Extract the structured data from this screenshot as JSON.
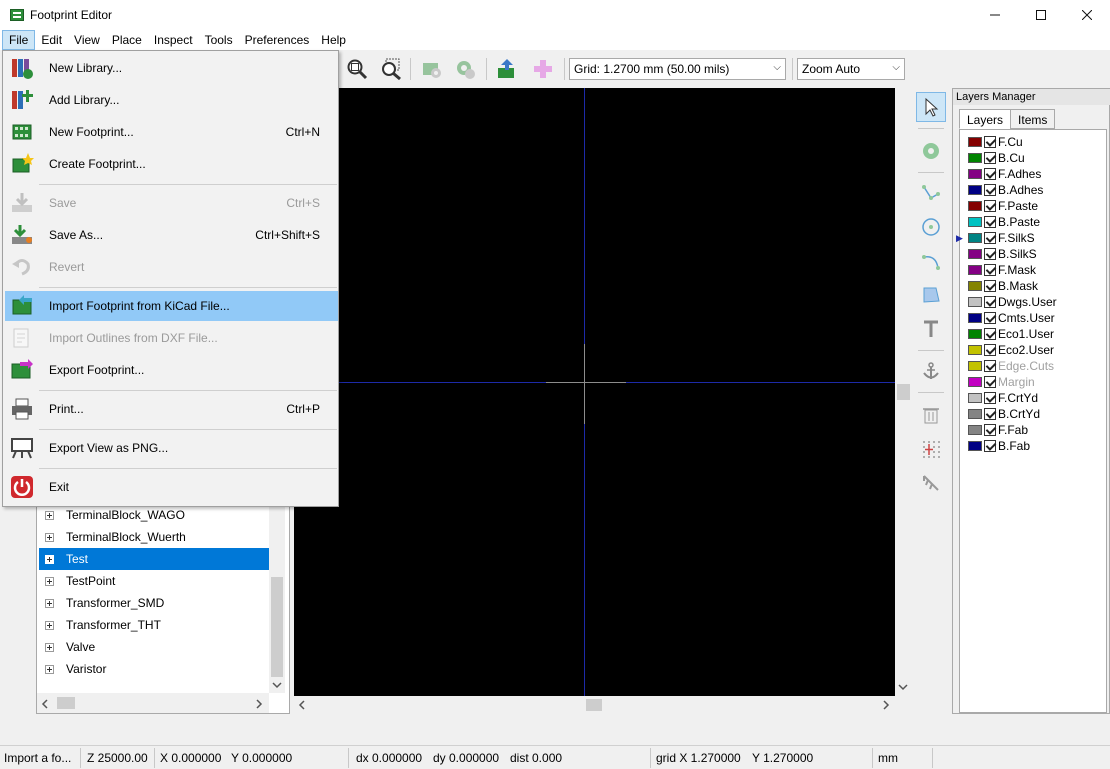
{
  "window": {
    "title": "Footprint Editor"
  },
  "menubar": {
    "items": [
      "File",
      "Edit",
      "View",
      "Place",
      "Inspect",
      "Tools",
      "Preferences",
      "Help"
    ]
  },
  "toolbar": {
    "grid_select": "Grid: 1.2700 mm (50.00 mils)",
    "zoom_select": "Zoom Auto"
  },
  "file_menu": {
    "items": [
      {
        "label": "New Library...",
        "shortcut": "",
        "icon": "new-library-icon"
      },
      {
        "label": "Add Library...",
        "shortcut": "",
        "icon": "add-library-icon"
      },
      {
        "label": "New Footprint...",
        "shortcut": "Ctrl+N",
        "icon": "new-footprint-icon"
      },
      {
        "label": "Create Footprint...",
        "shortcut": "",
        "icon": "create-footprint-icon"
      },
      {
        "label": "Save",
        "shortcut": "Ctrl+S",
        "icon": "save-icon"
      },
      {
        "label": "Save As...",
        "shortcut": "Ctrl+Shift+S",
        "icon": "save-as-icon"
      },
      {
        "label": "Revert",
        "shortcut": "",
        "icon": "revert-icon"
      },
      {
        "label": "Import Footprint from KiCad File...",
        "shortcut": "",
        "icon": "import-footprint-icon"
      },
      {
        "label": "Import Outlines from DXF File...",
        "shortcut": "",
        "icon": "import-dxf-icon"
      },
      {
        "label": "Export Footprint...",
        "shortcut": "",
        "icon": "export-footprint-icon"
      },
      {
        "label": "Print...",
        "shortcut": "Ctrl+P",
        "icon": "print-icon"
      },
      {
        "label": "Export View as PNG...",
        "shortcut": "",
        "icon": "export-png-icon"
      },
      {
        "label": "Exit",
        "shortcut": "",
        "icon": "exit-icon"
      }
    ]
  },
  "libraries": {
    "items": [
      "TerminalBlock_WAGO",
      "TerminalBlock_Wuerth",
      "Test",
      "TestPoint",
      "Transformer_SMD",
      "Transformer_THT",
      "Valve",
      "Varistor"
    ],
    "selected": "Test"
  },
  "layers_manager": {
    "title": "Layers Manager",
    "tabs": [
      "Layers",
      "Items"
    ],
    "active_tab": "Layers",
    "active_layer": "F.SilkS",
    "layers": [
      {
        "name": "F.Cu",
        "color": "#840000"
      },
      {
        "name": "B.Cu",
        "color": "#008400"
      },
      {
        "name": "F.Adhes",
        "color": "#840084"
      },
      {
        "name": "B.Adhes",
        "color": "#000084"
      },
      {
        "name": "F.Paste",
        "color": "#840000"
      },
      {
        "name": "B.Paste",
        "color": "#00c2c2"
      },
      {
        "name": "F.SilkS",
        "color": "#008484"
      },
      {
        "name": "B.SilkS",
        "color": "#840084"
      },
      {
        "name": "F.Mask",
        "color": "#840084"
      },
      {
        "name": "B.Mask",
        "color": "#848400"
      },
      {
        "name": "Dwgs.User",
        "color": "#c2c2c2"
      },
      {
        "name": "Cmts.User",
        "color": "#000084"
      },
      {
        "name": "Eco1.User",
        "color": "#008400"
      },
      {
        "name": "Eco2.User",
        "color": "#c2c200"
      },
      {
        "name": "Edge.Cuts",
        "color": "#c2c200"
      },
      {
        "name": "Margin",
        "color": "#c200c2"
      },
      {
        "name": "F.CrtYd",
        "color": "#c2c2c2"
      },
      {
        "name": "B.CrtYd",
        "color": "#848484"
      },
      {
        "name": "F.Fab",
        "color": "#848484"
      },
      {
        "name": "B.Fab",
        "color": "#000084"
      }
    ]
  },
  "statusbar": {
    "message": "Import a fo...",
    "zoom": "Z 25000.00",
    "x": "X 0.000000",
    "y": "Y 0.000000",
    "dx": "dx 0.000000",
    "dy": "dy 0.000000",
    "dist": "dist 0.000",
    "grid_x": "grid X 1.270000",
    "grid_y": "Y 1.270000",
    "units": "mm"
  }
}
